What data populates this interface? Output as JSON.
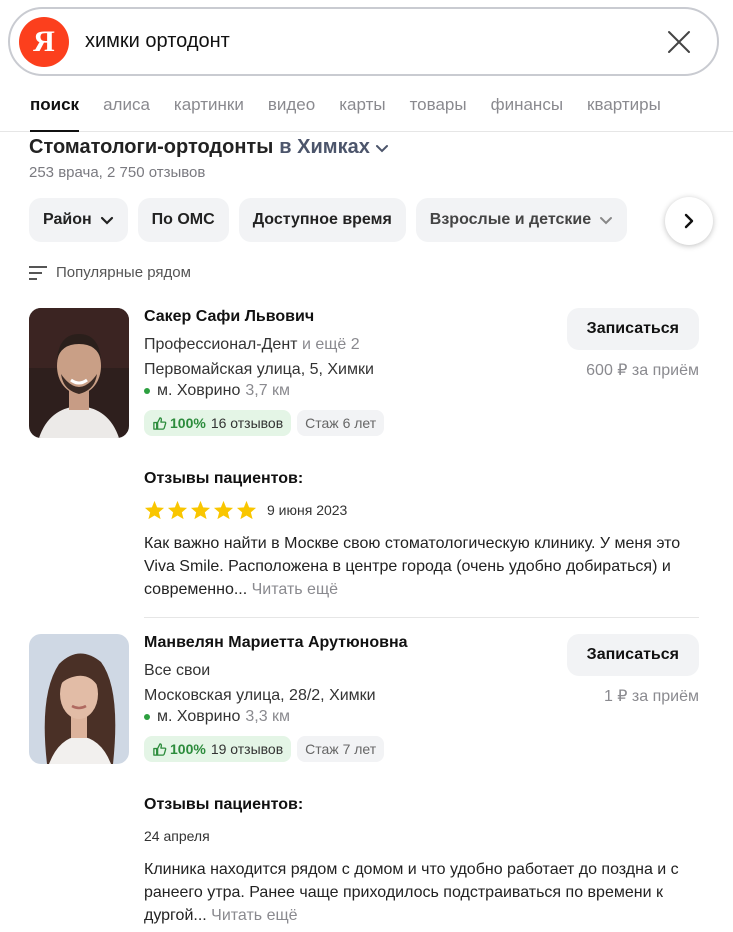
{
  "search": {
    "logo_letter": "Я",
    "query": "химки ортодонт"
  },
  "tabs": [
    "поиск",
    "алиса",
    "картинки",
    "видео",
    "карты",
    "товары",
    "финансы",
    "квартиры"
  ],
  "results": {
    "title": "Стоматологи-ортодонты",
    "city": "в Химках",
    "subtitle": "253 врача, 2 750 отзывов",
    "filters": [
      "Район",
      "По ОМС",
      "Доступное время",
      "Взрослые и детские"
    ],
    "sort_label": "Популярные рядом"
  },
  "doctors": [
    {
      "name": "Сакер Сафи Львович",
      "clinic": "Профессионал-Дент",
      "clinic_more": "и ещё 2",
      "address": "Первомайская улица, 5, Химки",
      "metro": "м. Ховрино",
      "distance": "3,7 км",
      "rating": "100%",
      "reviews_count": "16 отзывов",
      "experience": "Стаж 6 лет",
      "book_label": "Записаться",
      "price": "600 ₽ за приём",
      "reviews_title": "Отзывы пациентов:",
      "review_stars": 5,
      "review_date": "9 июня 2023",
      "review_text": "Как важно найти в Москве свою стоматологическую клинику. У меня это Viva Smile. Расположена в центре города (очень удобно добираться) и современно...",
      "read_more": "Читать ещё"
    },
    {
      "name": "Манвелян Мариетта Арутюновна",
      "clinic": "Все свои",
      "address": "Московская улица, 28/2, Химки",
      "metro": "м. Ховрино",
      "distance": "3,3 км",
      "rating": "100%",
      "reviews_count": "19 отзывов",
      "experience": "Стаж 7 лет",
      "book_label": "Записаться",
      "price": "1 ₽ за приём",
      "reviews_title": "Отзывы пациентов:",
      "review_date": "24 апреля",
      "review_text": "Клиника находится рядом с домом и что удобно работает до поздна и с ранеего утра. Ранее чаще приходилось подстраиваться по времени к дургой...",
      "read_more": "Читать ещё"
    }
  ],
  "colors": {
    "logo": "#fc3f1d",
    "rating_bg": "#e4f5e6",
    "rating_text": "#2c8c3c",
    "star": "#f9c600",
    "metro_dot": "#2c9f3f"
  }
}
